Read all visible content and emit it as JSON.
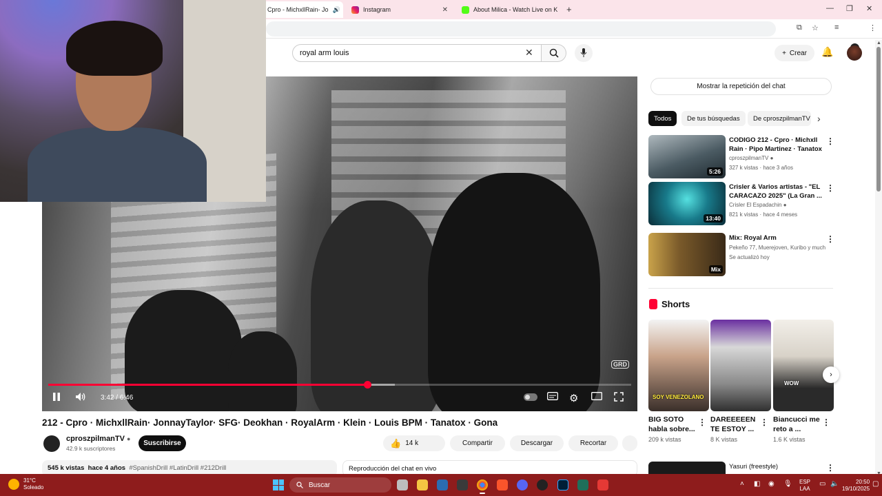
{
  "browser": {
    "tabs": [
      {
        "title": "Cpro - MichxllRain- Jo",
        "active": true
      },
      {
        "title": "Instagram",
        "active": false
      },
      {
        "title": "About Milica - Watch Live on K",
        "active": false
      }
    ],
    "new_tab_icon": "plus-icon"
  },
  "header": {
    "search_value": "royal arm louis",
    "create_label": "Crear"
  },
  "player": {
    "time": "3:42 / 6:46",
    "progress_fraction": 0.547,
    "buffer_fraction": 0.595,
    "watermark": "GRD"
  },
  "video": {
    "title": "212 - Cpro · MichxllRain· JonnayTaylor· SFG· Deokhan · RoyalArm · Klein · Louis BPM · Tanatox · Gona",
    "channel": "cproszpilmanTV",
    "subscribers": "42.9 k suscriptores",
    "subscribe_label": "Suscribirse",
    "likes": "14 k",
    "share_label": "Compartir",
    "download_label": "Descargar",
    "clip_label": "Recortar",
    "views": "545 k vistas",
    "age": "hace 4 años",
    "hashtags": "#SpanishDrill #LatinDrill #212Drill",
    "chat_replay_label": "Reproducción del chat en vivo"
  },
  "sidebar": {
    "chat_replay_button": "Mostrar la repetición del chat",
    "chips": [
      "Todos",
      "De tus búsquedas",
      "De cproszpilmanTV"
    ],
    "recommendations": [
      {
        "title": "CODIGO 212 - Cpro · Michxll Rain · Pipo Martinez · Tanatox ...",
        "channel": "cproszpilmanTV",
        "meta": "327 k vistas · hace 3 años",
        "duration": "5:26",
        "verified": true
      },
      {
        "title": "Crisler & Varios artistas - \"EL CARACAZO 2025\" (La Gran ...",
        "channel": "Crisler El Espadachin",
        "meta": "821 k vistas · hace 4 meses",
        "duration": "13:40",
        "verified": true
      },
      {
        "title": "Mix: Royal Arm",
        "channel": "Pekeño 77, Muerejoven, Kuribo y mucho...",
        "meta": "Se actualizó hoy",
        "duration": "Mix",
        "verified": false
      }
    ],
    "shorts_heading": "Shorts",
    "shorts": [
      {
        "title": "BIG SOTO habla sobre...",
        "views": "209 k vistas",
        "caption": "SOY VENEZOLANO"
      },
      {
        "title": "DAREEEEEN TE ESTOY ...",
        "views": "8 K vistas",
        "caption": ""
      },
      {
        "title": "Biancucci me reto a ...",
        "views": "1.6 K vistas",
        "caption": "WOW"
      }
    ],
    "next_rec_title": "Yasuri (freestyle)"
  },
  "taskbar": {
    "temperature": "31°C",
    "weather": "Soleado",
    "search_placeholder": "Buscar",
    "lang_top": "ESP",
    "lang_bottom": "LAA",
    "time": "20:50",
    "date": "19/10/2025"
  },
  "colors": {
    "accent": "#ff0033",
    "taskbar": "#8e1c1c",
    "tabbar": "#fbe4ea"
  }
}
